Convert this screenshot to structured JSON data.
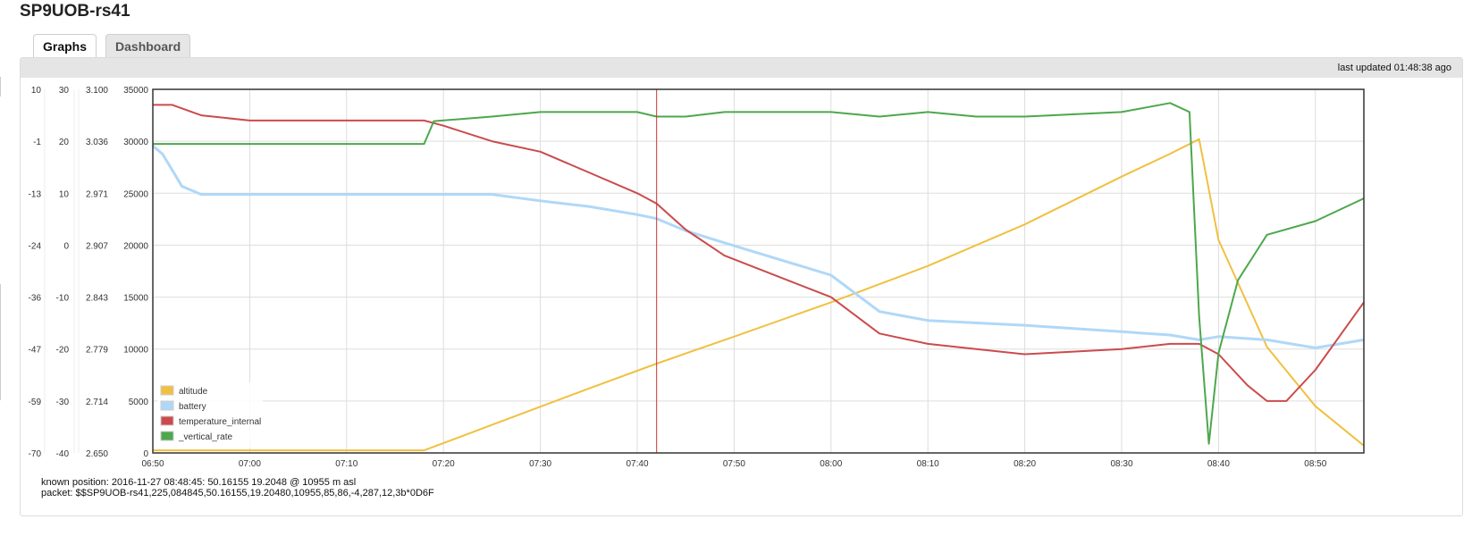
{
  "page": {
    "title": "SP9UOB-rs41"
  },
  "tabs": [
    {
      "label": "Graphs",
      "active": true
    },
    {
      "label": "Dashboard",
      "active": false
    }
  ],
  "panel": {
    "last_updated": "last updated 01:48:38 ago"
  },
  "info": {
    "known_position": "known position: 2016-11-27 08:48:45: 50.16155 19.2048 @ 10955 m asl",
    "packet": "packet: $$SP9UOB-rs41,225,084845,50.16155,19.20480,10955,85,86,-4,287,12,3b*0D6F"
  },
  "colors": {
    "altitude": "#f0c040",
    "battery": "#afd8f8",
    "temperature_internal": "#cb4b4b",
    "_vertical_rate": "#4da74d",
    "marker": "#cc3333",
    "grid": "#dddddd"
  },
  "chart_data": {
    "type": "line",
    "x_tick_labels": [
      "06:50",
      "07:00",
      "07:10",
      "07:20",
      "07:30",
      "07:40",
      "07:50",
      "08:00",
      "08:10",
      "08:20",
      "08:30",
      "08:40",
      "08:50"
    ],
    "xlim": [
      "06:50",
      "08:55"
    ],
    "marker_time": "07:42",
    "legend": {
      "position": "bottom-left"
    },
    "grid": true,
    "axes": [
      {
        "id": "vertical_rate",
        "ticks": [
          "10",
          "-1",
          "-13",
          "-24",
          "-36",
          "-47",
          "-59",
          "-70"
        ],
        "ylim": [
          -70,
          10
        ]
      },
      {
        "id": "temperature_internal",
        "ticks": [
          "30",
          "20",
          "10",
          "0",
          "-10",
          "-20",
          "-30",
          "-40"
        ],
        "ylim": [
          -40,
          30
        ]
      },
      {
        "id": "battery",
        "ticks": [
          "3.100",
          "3.036",
          "2.971",
          "2.907",
          "2.843",
          "2.779",
          "2.714",
          "2.650"
        ],
        "ylim": [
          2.65,
          3.1
        ]
      },
      {
        "id": "altitude",
        "ticks": [
          "35000",
          "30000",
          "25000",
          "20000",
          "15000",
          "10000",
          "5000",
          "0"
        ],
        "ylim": [
          0,
          35000
        ]
      }
    ],
    "series": [
      {
        "name": "altitude",
        "axis": "altitude",
        "color": "#f0c040",
        "x": [
          "06:50",
          "07:18",
          "07:25",
          "07:35",
          "07:42",
          "07:50",
          "08:00",
          "08:10",
          "08:20",
          "08:30",
          "08:35",
          "08:38",
          "08:40",
          "08:45",
          "08:50",
          "08:55"
        ],
        "y": [
          250,
          250,
          2700,
          6200,
          8600,
          11200,
          14500,
          18000,
          22000,
          26600,
          28800,
          30200,
          20500,
          10200,
          4500,
          700
        ]
      },
      {
        "name": "battery",
        "axis": "battery",
        "color": "#afd8f8",
        "x": [
          "06:50",
          "06:51",
          "06:52",
          "06:53",
          "06:55",
          "07:00",
          "07:10",
          "07:18",
          "07:25",
          "07:30",
          "07:35",
          "07:40",
          "07:42",
          "07:45",
          "07:49",
          "08:00",
          "08:05",
          "08:10",
          "08:20",
          "08:30",
          "08:35",
          "08:38",
          "08:40",
          "08:45",
          "08:50",
          "08:55"
        ],
        "y": [
          3.03,
          3.02,
          3.0,
          2.98,
          2.97,
          2.97,
          2.97,
          2.97,
          2.97,
          2.962,
          2.955,
          2.945,
          2.94,
          2.925,
          2.91,
          2.87,
          2.825,
          2.814,
          2.808,
          2.8,
          2.796,
          2.79,
          2.794,
          2.79,
          2.78,
          2.79
        ]
      },
      {
        "name": "temperature_internal",
        "axis": "temperature_internal",
        "color": "#cb4b4b",
        "x": [
          "06:50",
          "06:52",
          "06:55",
          "07:00",
          "07:10",
          "07:18",
          "07:20",
          "07:25",
          "07:30",
          "07:35",
          "07:40",
          "07:42",
          "07:45",
          "07:49",
          "08:00",
          "08:05",
          "08:10",
          "08:15",
          "08:20",
          "08:30",
          "08:35",
          "08:38",
          "08:40",
          "08:43",
          "08:45",
          "08:47",
          "08:50",
          "08:55"
        ],
        "y": [
          27,
          27,
          25,
          24,
          24,
          24,
          23,
          20,
          18,
          14,
          10,
          8,
          3,
          -2,
          -10,
          -17,
          -19,
          -20,
          -21,
          -20,
          -19,
          -19,
          -21,
          -27,
          -30,
          -30,
          -24,
          -11
        ]
      },
      {
        "name": "_vertical_rate",
        "axis": "vertical_rate",
        "color": "#4da74d",
        "x": [
          "06:50",
          "07:00",
          "07:10",
          "07:18",
          "07:19",
          "07:25",
          "07:30",
          "07:40",
          "07:42",
          "07:45",
          "07:49",
          "08:00",
          "08:05",
          "08:10",
          "08:15",
          "08:20",
          "08:30",
          "08:35",
          "08:37",
          "08:38",
          "08:39",
          "08:40",
          "08:42",
          "08:45",
          "08:50",
          "08:55"
        ],
        "y": [
          -2,
          -2,
          -2,
          -2,
          3,
          4,
          5,
          5,
          4,
          4,
          5,
          5,
          4,
          5,
          4,
          4,
          5,
          7,
          5,
          -40,
          -68,
          -48,
          -32,
          -22,
          -19,
          -14
        ]
      }
    ]
  }
}
